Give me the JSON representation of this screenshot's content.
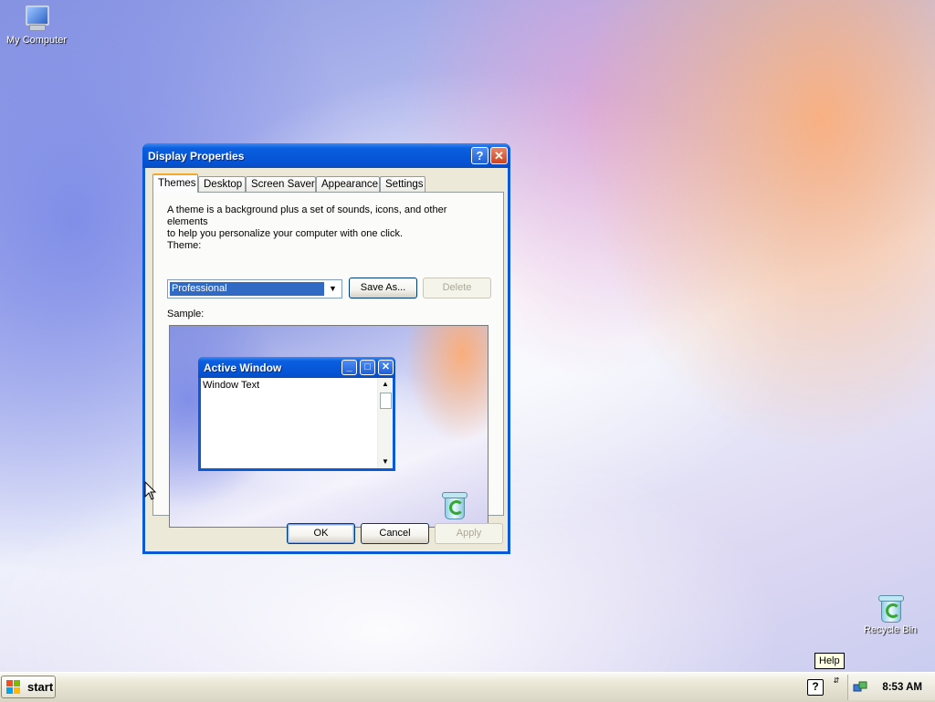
{
  "desktop": {
    "icons": [
      {
        "label": "My Computer"
      },
      {
        "label": "Recycle Bin"
      }
    ]
  },
  "dialog": {
    "title": "Display Properties",
    "tabs": [
      {
        "label": "Themes",
        "active": true
      },
      {
        "label": "Desktop"
      },
      {
        "label": "Screen Saver"
      },
      {
        "label": "Appearance"
      },
      {
        "label": "Settings"
      }
    ],
    "description_line1": "A theme is a background plus a set of sounds, icons, and other elements",
    "description_line2": "to help you personalize your computer with one click.",
    "theme_label": "Theme:",
    "theme_value": "Professional",
    "save_as_label": "Save As...",
    "delete_label": "Delete",
    "sample_label": "Sample:",
    "sample_window": {
      "title": "Active Window",
      "text": "Window Text"
    },
    "ok_label": "OK",
    "cancel_label": "Cancel",
    "apply_label": "Apply"
  },
  "taskbar": {
    "start_label": "start",
    "clock": "8:53 AM",
    "tooltip": "Help"
  },
  "colors": {
    "title_bar": "#0553d4",
    "selection": "#316ac5",
    "dialog_face": "#ece9d8"
  }
}
